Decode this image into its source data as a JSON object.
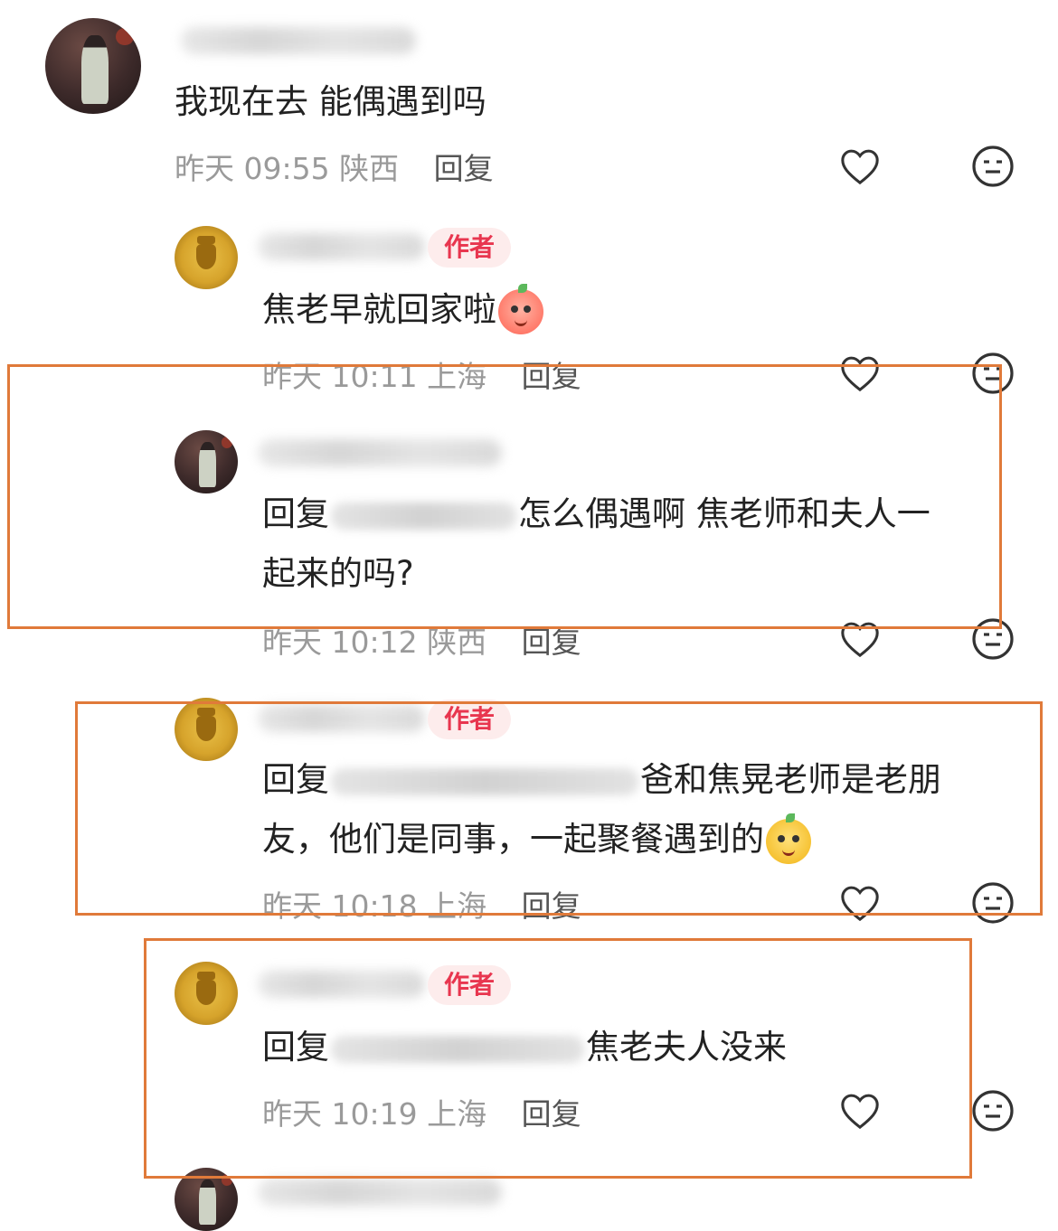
{
  "comments": [
    {
      "text": "我现在去 能偶遇到吗",
      "time": "昨天 09:55",
      "location": "陕西",
      "reply_label": "回复"
    },
    {
      "badge": "作者",
      "text": "焦老早就回家啦",
      "time": "昨天 10:11",
      "location": "上海",
      "reply_label": "回复"
    },
    {
      "prefix": "回复",
      "text_after": "怎么偶遇啊 焦老师和夫人一",
      "text_line2": "起来的吗?",
      "time": "昨天 10:12",
      "location": "陕西",
      "reply_label": "回复"
    },
    {
      "badge": "作者",
      "prefix": "回复",
      "text_after": "爸和焦晃老师是老朋",
      "text_line2": "友，他们是同事，一起聚餐遇到的",
      "time": "昨天 10:18",
      "location": "上海",
      "reply_label": "回复"
    },
    {
      "badge": "作者",
      "prefix": "回复",
      "text_after": "焦老夫人没来",
      "time": "昨天 10:19",
      "location": "上海",
      "reply_label": "回复"
    }
  ],
  "icons": {
    "like": "heart-outline-icon",
    "dislike": "meh-face-icon",
    "emoji_1": "peach-emoji",
    "emoji_2": "yellow-emoji"
  },
  "colors": {
    "author_badge_text": "#e8364f",
    "author_badge_bg": "#fdecec",
    "highlight_frame": "#e07a3a",
    "meta_text": "#9a9a9a"
  }
}
